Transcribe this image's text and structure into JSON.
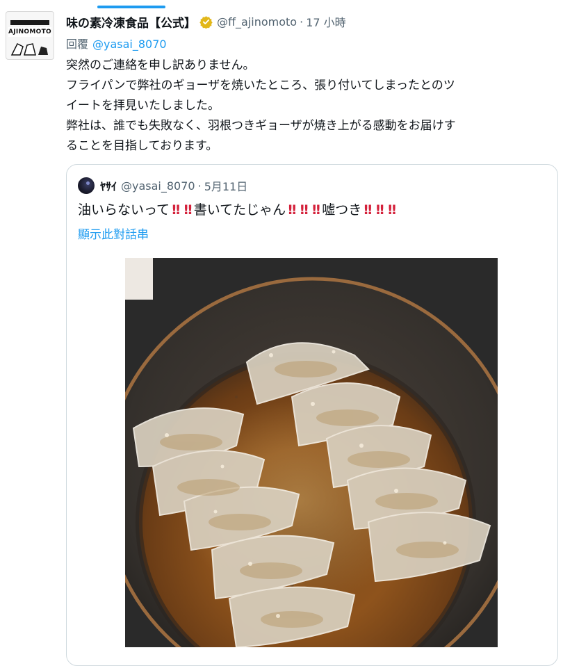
{
  "tweet": {
    "display_name": "味の素冷凍食品【公式】",
    "handle": "@ff_ajinomoto",
    "separator": "·",
    "time": "17 小時",
    "reply_prefix": "回覆",
    "reply_mention": "@yasai_8070",
    "lines": [
      "突然のご連絡を申し訳ありません。",
      "フライパンで弊社のギョーザを焼いたところ、張り付いてしまったとのツ",
      "イートを拝見いたしました。",
      "弊社は、誰でも失敗なく、羽根つきギョーザが焼き上がる感動をお届けす",
      "ることを目指しております。"
    ],
    "avatar_brand": "AJINOMOTO"
  },
  "quote": {
    "name": "ﾔｻｲ",
    "handle": "@yasai_8070",
    "separator": "·",
    "date": "5月11日",
    "text_parts": [
      "油いらないって",
      "書いてたじゃん",
      "嘘つき"
    ],
    "bang": "!!",
    "show_thread": "顯示此對話串"
  },
  "colors": {
    "link": "#1d9bf0",
    "secondary_text": "#536471",
    "border": "#cfd9de",
    "verified_gold": "#e2b719",
    "emphasis_red": "#d4213b"
  },
  "icons": {
    "verified": "verified-badge-icon"
  }
}
